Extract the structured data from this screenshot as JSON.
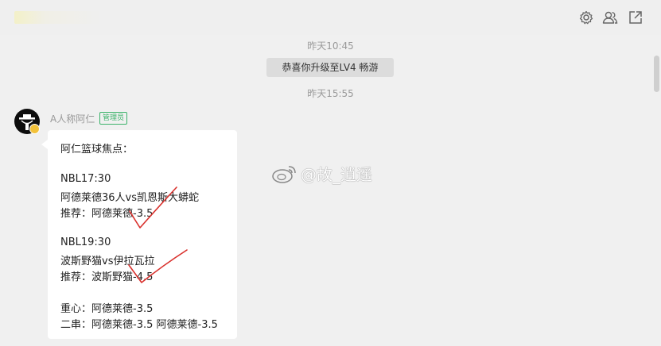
{
  "header": {
    "icons": [
      "settings-icon",
      "members-icon",
      "popout-icon"
    ]
  },
  "chat": {
    "timestamps": [
      "昨天10:45",
      "昨天15:55"
    ],
    "system_notice": "恭喜你升级至LV4 畅游",
    "message": {
      "sender": "A人称阿仁",
      "role_badge": "管理员",
      "lines": [
        "阿仁篮球焦点：",
        "NBL17:30",
        "阿德莱德36人vs凯恩斯大蟒蛇",
        "推荐：阿德莱德-3.5",
        "NBL19:30",
        "波斯野猫vs伊拉瓦拉",
        "推荐：波斯野猫-4.5",
        "重心：阿德莱德-3.5",
        "二串：阿德莱德-3.5 阿德莱德-3.5"
      ]
    }
  },
  "watermark": {
    "text": "@故_逍遥",
    "icon": "weibo-icon"
  },
  "colors": {
    "background": "#f0f0f0",
    "bubble": "#ffffff",
    "admin_badge": "#3bb36a",
    "handwritten_check": "#d9302c"
  }
}
